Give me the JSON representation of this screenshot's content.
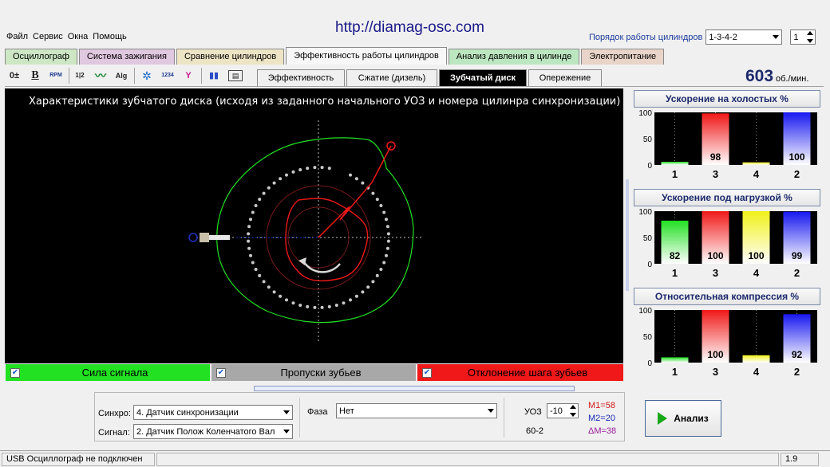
{
  "url": "http://diamag-osc.com",
  "menu": [
    "Файл",
    "Сервис",
    "Окна",
    "Помощь"
  ],
  "cylinder_order": {
    "label": "Порядок работы цилиндров",
    "value": "1-3-4-2",
    "spin": "1"
  },
  "main_tabs": [
    {
      "label": "Осциллограф",
      "color": "#cde6c4"
    },
    {
      "label": "Система зажигания",
      "color": "#e0c8e0"
    },
    {
      "label": "Сравнение цилиндров",
      "color": "#ece4c4"
    },
    {
      "label": "Эффективность работы цилиндров",
      "color": "#f7f7f7"
    },
    {
      "label": "Анализ давления в цилинде",
      "color": "#bce6c0"
    },
    {
      "label": "Электропитание",
      "color": "#e8d4c8"
    }
  ],
  "toolbar_icons": [
    "arrows-icon",
    "bold-b-icon",
    "rpm-icon",
    "numbers-icon",
    "wave-icon",
    "alg-icon",
    "bug-icon",
    "counter-icon",
    "filter-icon",
    "bars-icon",
    "meter-icon"
  ],
  "toolbar_icon_text": [
    "0±",
    "B",
    "RPM",
    "1|2",
    "〰",
    "Alg",
    "✲",
    "1234",
    "Y",
    "▮▮",
    "▤"
  ],
  "sub_tabs": [
    "Эффективность",
    "Сжатие (дизель)",
    "Зубчатый диск",
    "Опережение"
  ],
  "active_sub_tab": "Зубчатый диск",
  "rpm": {
    "value": "603",
    "unit": "об./мин."
  },
  "scope": {
    "title": "Характеристики зубчатого диска (исходя из заданного начального УОЗ и номера цилинра синхронизации)"
  },
  "legend": [
    {
      "label": "Сила сигнала",
      "color": "#22e022",
      "text_color": "#000000",
      "checked": true
    },
    {
      "label": "Пропуски зубьев",
      "color": "#a8a8a8",
      "text_color": "#000000",
      "checked": true
    },
    {
      "label": "Отклонение шага зубьев",
      "color": "#f01818",
      "text_color": "#000000",
      "checked": true
    }
  ],
  "charts": [
    {
      "title": "Ускорение на холостых %",
      "ticks": [
        "100",
        "50",
        "0"
      ]
    },
    {
      "title": "Ускорение под нагрузкой %",
      "ticks": [
        "100",
        "50",
        "0"
      ]
    },
    {
      "title": "Относительная компрессия %",
      "ticks": [
        "100",
        "50",
        "0"
      ]
    }
  ],
  "chart_data": [
    {
      "type": "bar",
      "title": "Ускорение на холостых %",
      "categories": [
        "1",
        "3",
        "4",
        "2"
      ],
      "values": [
        6,
        98,
        5,
        100
      ],
      "labels": [
        "",
        "98",
        "",
        "100"
      ],
      "colors": [
        "#22e022",
        "#f01818",
        "#f0f018",
        "#1818f0"
      ],
      "ylim": [
        0,
        100
      ],
      "yticks": [
        "100",
        "50",
        "0"
      ]
    },
    {
      "type": "bar",
      "title": "Ускорение под нагрузкой %",
      "categories": [
        "1",
        "3",
        "4",
        "2"
      ],
      "values": [
        82,
        100,
        100,
        99
      ],
      "labels": [
        "82",
        "100",
        "100",
        "99"
      ],
      "colors": [
        "#22e022",
        "#f01818",
        "#f0f018",
        "#1818f0"
      ],
      "ylim": [
        0,
        100
      ],
      "yticks": [
        "100",
        "50",
        "0"
      ]
    },
    {
      "type": "bar",
      "title": "Относительная компрессия %",
      "categories": [
        "1",
        "3",
        "4",
        "2"
      ],
      "values": [
        10,
        100,
        14,
        92
      ],
      "labels": [
        "",
        "100",
        "",
        "92"
      ],
      "colors": [
        "#22e022",
        "#f01818",
        "#f0f018",
        "#1818f0"
      ],
      "ylim": [
        0,
        100
      ],
      "yticks": [
        "100",
        "50",
        "0"
      ]
    }
  ],
  "bottom": {
    "sync_label": "Синхро:",
    "sync_value": "4.  Датчик синхронизации",
    "signal_label": "Сигнал:",
    "signal_value": "2.  Датчик Полож Коленчатого Вал",
    "phase_label": "Фаза",
    "phase_value": "Нет",
    "uoz_label": "УОЗ",
    "uoz_value": "-10",
    "teeth": "60-2",
    "m1": "M1=58",
    "m2": "M2=20",
    "dm": "ΔM=38",
    "analyze": "Анализ"
  },
  "status": {
    "text": "USB Осциллограф не подключен",
    "version": "1.9"
  }
}
